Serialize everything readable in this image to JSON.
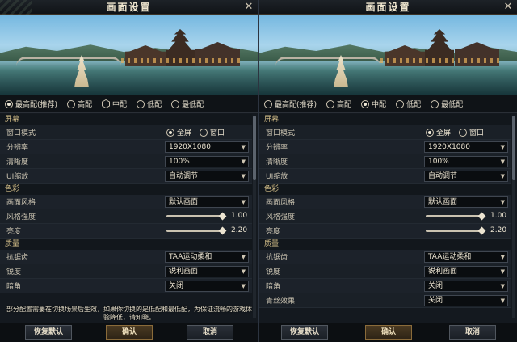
{
  "window": {
    "title": "画面设置"
  },
  "preview_image": {
    "description_icon": "landscape-preview"
  },
  "quality_presets": [
    "最高配(推荐)",
    "高配",
    "中配",
    "低配",
    "最低配"
  ],
  "left": {
    "selected_preset": "中配",
    "sections": {
      "screen": "屏幕",
      "color": "色彩",
      "quality": "质量"
    },
    "rows": {
      "window_mode": {
        "label": "窗口模式",
        "options": [
          "全屏",
          "窗口"
        ],
        "selected": "全屏"
      },
      "resolution": {
        "label": "分辨率",
        "value": "1920X1080"
      },
      "clarity": {
        "label": "清晰度",
        "value": "100%"
      },
      "ui_scale": {
        "label": "UI缩放",
        "value": "自动调节"
      },
      "style": {
        "label": "画面风格",
        "value": "默认画面"
      },
      "style_strength": {
        "label": "风格强度",
        "value": "1.00",
        "fraction": 1.0
      },
      "brightness": {
        "label": "亮度",
        "value": "2.20",
        "fraction": 1.0
      },
      "antialias": {
        "label": "抗锯齿",
        "value": "TAA运动柔和"
      },
      "sharpness": {
        "label": "锐度",
        "value": "锐利画面"
      },
      "dark_corner": {
        "label": "暗角",
        "value": "关闭"
      }
    },
    "notice": "部分配置需要在切换场景后生效，如果你切换的是低配和最低配，为保证流畅的游戏体验降低，请知晓。",
    "buttons": {
      "reset": "恢复默认",
      "confirm": "确认",
      "cancel": "取消"
    }
  },
  "right": {
    "selected_preset": "中配",
    "sections": {
      "screen": "屏幕",
      "color": "色彩",
      "quality": "质量"
    },
    "rows": {
      "window_mode": {
        "label": "窗口模式",
        "options": [
          "全屏",
          "窗口"
        ],
        "selected": "全屏"
      },
      "resolution": {
        "label": "分辨率",
        "value": "1920X1080"
      },
      "clarity": {
        "label": "清晰度",
        "value": "100%"
      },
      "ui_scale": {
        "label": "UI缩放",
        "value": "自动调节"
      },
      "style": {
        "label": "画面风格",
        "value": "默认画面"
      },
      "style_strength": {
        "label": "风格强度",
        "value": "1.00",
        "fraction": 1.0
      },
      "brightness": {
        "label": "亮度",
        "value": "2.20",
        "fraction": 1.0
      },
      "antialias": {
        "label": "抗锯齿",
        "value": "TAA运动柔和"
      },
      "sharpness": {
        "label": "锐度",
        "value": "锐利画面"
      },
      "dark_corner": {
        "label": "暗角",
        "value": "关闭"
      },
      "blue_effect": {
        "label": "青丝效果",
        "value": "关闭"
      }
    },
    "buttons": {
      "reset": "恢复默认",
      "confirm": "确认",
      "cancel": "取消"
    }
  },
  "colors": {
    "accent_gold": "#d6c08a",
    "background": "#14191f"
  }
}
